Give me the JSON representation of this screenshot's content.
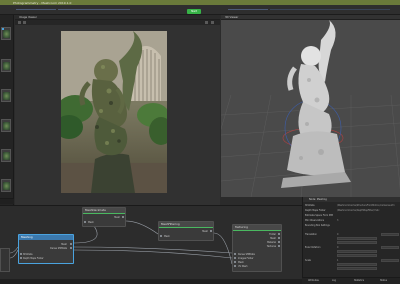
{
  "window": {
    "title": "Photogrammetry - Meshroom 2019.1.0"
  },
  "toolbar": {
    "start_label": "Start"
  },
  "panels": {
    "image_viewer": {
      "title": "Image Viewer"
    },
    "viewer_3d": {
      "title": "3D Viewer"
    }
  },
  "graph": {
    "nodes": {
      "meshing": {
        "title": "Meshing",
        "inputs": [
          "Mesh",
          "Dense SfMData"
        ],
        "outputs": [
          "SfmData",
          "Depth Maps Folder"
        ]
      },
      "mesh_decimate": {
        "title": "MeshDecimate",
        "outputs": [
          "Mesh"
        ],
        "inputs": [
          "Mesh"
        ]
      },
      "mesh_filtering": {
        "title": "MeshFiltering",
        "outputs": [
          "Mesh"
        ],
        "inputs": [
          "Mesh"
        ]
      },
      "texturing": {
        "title": "Texturing",
        "outputs": [
          "Folder",
          "Mesh",
          "Material",
          "Textures"
        ],
        "inputs": [
          "Dense SfMData",
          "Images Folder",
          "Mesh",
          "UV Mesh"
        ]
      }
    }
  },
  "attributes": {
    "header": "Node: Meshing",
    "rows": [
      {
        "key": "SfmData",
        "value": "/MeshroomCache/StructureFromMotion/cameras.sfm"
      },
      {
        "key": "Depth Maps Folder",
        "value": "/MeshroomCache/DepthMapFilter/7a2c"
      },
      {
        "key": "Estimate Space From SfM",
        "value": ""
      },
      {
        "key": "Min Observations",
        "value": "3"
      },
      {
        "key": "Bounding Box Settings",
        "value": ""
      },
      {
        "key": "Translation",
        "value": "0"
      },
      {
        "key": "",
        "value": ""
      },
      {
        "key": "Euler Rotation",
        "value": "0"
      },
      {
        "key": "",
        "value": ""
      },
      {
        "key": "Scale",
        "value": "1"
      }
    ],
    "tabs": [
      "Attributes",
      "Log",
      "Statistics",
      "Status"
    ]
  },
  "colors": {
    "accent": "#4aa3df",
    "start": "#37b347",
    "node_ok": "#4ab860",
    "selected_node": "#3b79ae"
  }
}
